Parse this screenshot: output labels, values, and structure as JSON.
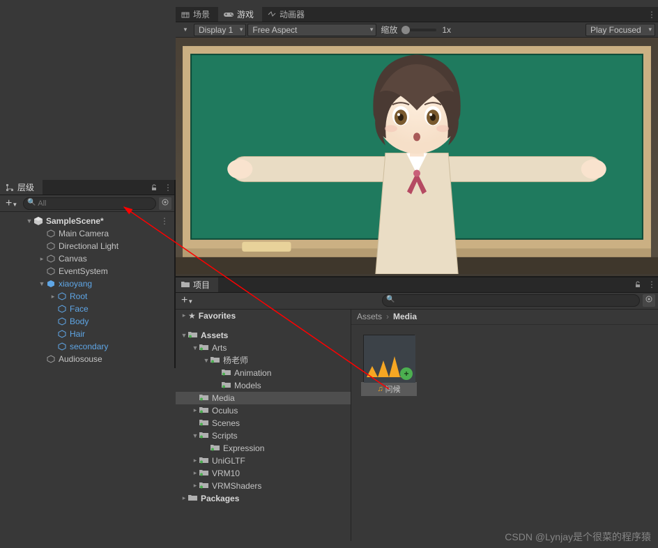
{
  "hierarchy": {
    "title": "层级",
    "search_placeholder": "All",
    "scene_name": "SampleScene*",
    "items": [
      {
        "name": "Main Camera"
      },
      {
        "name": "Directional Light"
      },
      {
        "name": "Canvas"
      },
      {
        "name": "EventSystem"
      },
      {
        "name": "xiaoyang"
      },
      {
        "name": "Root"
      },
      {
        "name": "Face"
      },
      {
        "name": "Body"
      },
      {
        "name": "Hair"
      },
      {
        "name": "secondary"
      },
      {
        "name": "Audiosouse"
      }
    ]
  },
  "game": {
    "tabs": {
      "scene": "场景",
      "game": "游戏",
      "animator": "动画器"
    },
    "display": "Display 1",
    "aspect": "Free Aspect",
    "scale_label": "缩放",
    "scale_value": "1x",
    "play": "Play Focused"
  },
  "project": {
    "title": "项目",
    "favorites": "Favorites",
    "tree": {
      "assets": "Assets",
      "arts": "Arts",
      "teacher": "杨老师",
      "animation": "Animation",
      "models": "Models",
      "media": "Media",
      "oculus": "Oculus",
      "scenes": "Scenes",
      "scripts": "Scripts",
      "expression": "Expression",
      "unigltf": "UniGLTF",
      "vrm10": "VRM10",
      "vrmshaders": "VRMShaders",
      "packages": "Packages"
    },
    "breadcrumb": {
      "root": "Assets",
      "sep": "›",
      "current": "Media"
    },
    "asset": {
      "name": "问候"
    }
  },
  "watermark": "CSDN @Lynjay是个很菜的程序猿"
}
